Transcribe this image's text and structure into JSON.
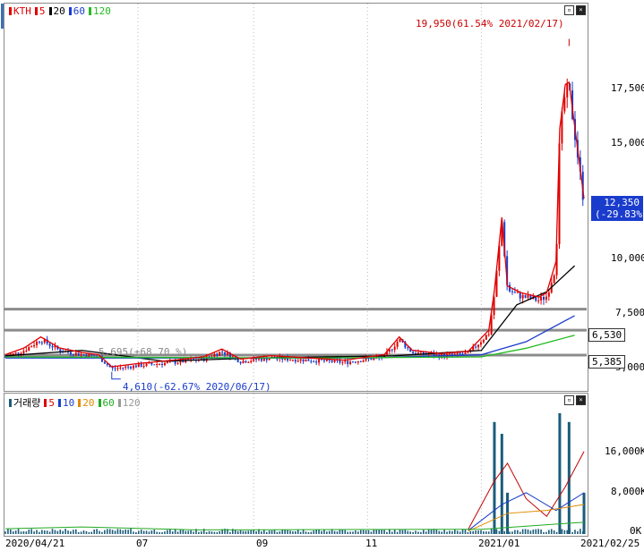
{
  "sidebar": {
    "toggle_label": "호"
  },
  "price_legend": {
    "symbol": "KTH",
    "ma": [
      {
        "label": "5",
        "color": "#e00000"
      },
      {
        "label": "20",
        "color": "#000000"
      },
      {
        "label": "60",
        "color": "#1a3ccc"
      },
      {
        "label": "120",
        "color": "#22bb22"
      }
    ]
  },
  "volume_legend": {
    "label": "거래량",
    "ma": [
      {
        "label": "5",
        "color": "#e00000"
      },
      {
        "label": "10",
        "color": "#1a3ccc"
      },
      {
        "label": "20",
        "color": "#e08a00"
      },
      {
        "label": "60",
        "color": "#22aa22"
      },
      {
        "label": "120",
        "color": "#999999"
      }
    ]
  },
  "price_axis": [
    "17,500",
    "15,000",
    "10,000",
    "7,500",
    "5,000"
  ],
  "volume_axis": [
    "16,000K",
    "8,000K",
    "0K"
  ],
  "x_axis": [
    "2020/04/21",
    "07",
    "09",
    "11",
    "2021/01",
    "2021/02/25"
  ],
  "annotations": {
    "high": "19,950(61.54% 2021/02/17)",
    "low": "4,610(-62.67% 2020/06/17)",
    "ref": "5,695(+68.70 %)"
  },
  "current": {
    "price": "12,350",
    "change": "(-29.83%)"
  },
  "levels": {
    "upper": "6,530",
    "lower": "5,385"
  },
  "chart_data": {
    "type": "candlestick",
    "symbol": "KTH",
    "x_range": [
      "2020/04/21",
      "2021/02/25"
    ],
    "ylim": [
      3900,
      21000
    ],
    "price_ticks": [
      5000,
      7500,
      10000,
      15000,
      17500
    ],
    "high": {
      "value": 19950,
      "date": "2021/02/17",
      "change_pct": 61.54
    },
    "low": {
      "value": 4610,
      "date": "2020/06/17",
      "change_pct": -62.67
    },
    "last": {
      "value": 12350,
      "change_pct": -29.83
    },
    "horizontal_lines": [
      7500,
      6530,
      5385
    ],
    "close_series": [
      {
        "x": "2020/04/21",
        "y": 5300
      },
      {
        "x": "2020/05/01",
        "y": 5600
      },
      {
        "x": "2020/05/10",
        "y": 6100
      },
      {
        "x": "2020/05/20",
        "y": 5600
      },
      {
        "x": "2020/06/01",
        "y": 5400
      },
      {
        "x": "2020/06/10",
        "y": 5300
      },
      {
        "x": "2020/06/17",
        "y": 4750
      },
      {
        "x": "2020/07/01",
        "y": 4900
      },
      {
        "x": "2020/07/20",
        "y": 5050
      },
      {
        "x": "2020/08/05",
        "y": 5200
      },
      {
        "x": "2020/08/15",
        "y": 5550
      },
      {
        "x": "2020/08/25",
        "y": 5100
      },
      {
        "x": "2020/09/10",
        "y": 5250
      },
      {
        "x": "2020/10/01",
        "y": 5150
      },
      {
        "x": "2020/10/20",
        "y": 5050
      },
      {
        "x": "2020/11/10",
        "y": 5300
      },
      {
        "x": "2020/11/18",
        "y": 6100
      },
      {
        "x": "2020/11/25",
        "y": 5500
      },
      {
        "x": "2020/12/10",
        "y": 5350
      },
      {
        "x": "2020/12/25",
        "y": 5450
      },
      {
        "x": "2021/01/05",
        "y": 6400
      },
      {
        "x": "2021/01/08",
        "y": 8200
      },
      {
        "x": "2021/01/12",
        "y": 11500
      },
      {
        "x": "2021/01/15",
        "y": 8400
      },
      {
        "x": "2021/01/22",
        "y": 8100
      },
      {
        "x": "2021/02/01",
        "y": 7900
      },
      {
        "x": "2021/02/05",
        "y": 8100
      },
      {
        "x": "2021/02/10",
        "y": 9500
      },
      {
        "x": "2021/02/12",
        "y": 15500
      },
      {
        "x": "2021/02/15",
        "y": 17500
      },
      {
        "x": "2021/02/17",
        "y": 17600
      },
      {
        "x": "2021/02/25",
        "y": 12350
      }
    ],
    "volume": {
      "ylim": [
        0,
        22000
      ],
      "ticks": [
        0,
        8000,
        16000
      ],
      "unit": "K",
      "spikes": [
        {
          "x": "2021/01/08",
          "y": 19000
        },
        {
          "x": "2021/01/12",
          "y": 17000
        },
        {
          "x": "2021/01/15",
          "y": 7000
        },
        {
          "x": "2021/02/12",
          "y": 20500
        },
        {
          "x": "2021/02/17",
          "y": 19000
        },
        {
          "x": "2021/02/25",
          "y": 7000
        }
      ]
    }
  }
}
